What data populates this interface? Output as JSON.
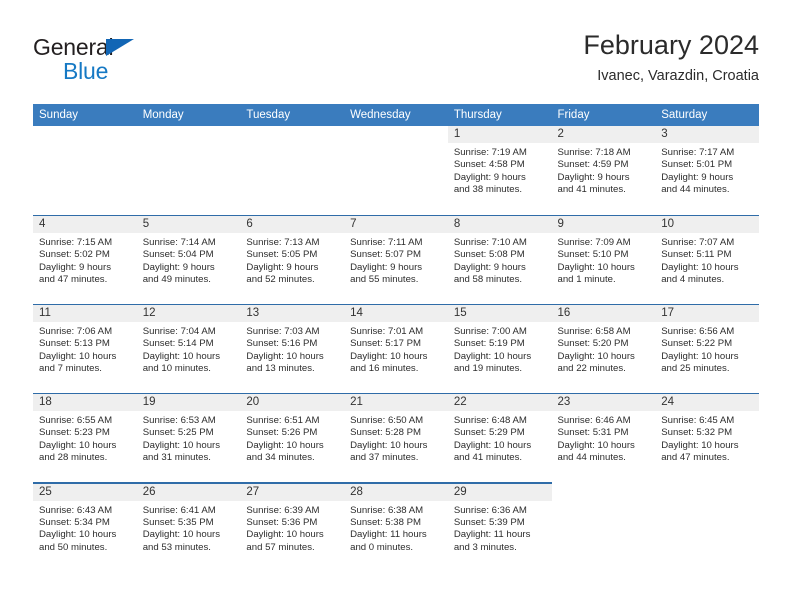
{
  "brand": {
    "name_part1": "General",
    "name_part2": "Blue",
    "colors": {
      "dark": "#231f20",
      "blue": "#1679c4",
      "triangle": "#1266b5"
    }
  },
  "header": {
    "title": "February 2024",
    "subtitle": "Ivanec, Varazdin, Croatia"
  },
  "theme": {
    "header_bg": "#3a7cbe",
    "header_text": "#ffffff",
    "row_divider": "#2f6ca8",
    "day_number_bg": "#efefef",
    "body_text": "#2d2d2d"
  },
  "weekdays": [
    "Sunday",
    "Monday",
    "Tuesday",
    "Wednesday",
    "Thursday",
    "Friday",
    "Saturday"
  ],
  "weeks": [
    [
      {
        "day": "",
        "sunrise": "",
        "sunset": "",
        "daylight_line1": "",
        "daylight_line2": "",
        "blank": true
      },
      {
        "day": "",
        "sunrise": "",
        "sunset": "",
        "daylight_line1": "",
        "daylight_line2": "",
        "blank": true
      },
      {
        "day": "",
        "sunrise": "",
        "sunset": "",
        "daylight_line1": "",
        "daylight_line2": "",
        "blank": true
      },
      {
        "day": "",
        "sunrise": "",
        "sunset": "",
        "daylight_line1": "",
        "daylight_line2": "",
        "blank": true
      },
      {
        "day": "1",
        "sunrise": "Sunrise: 7:19 AM",
        "sunset": "Sunset: 4:58 PM",
        "daylight_line1": "Daylight: 9 hours",
        "daylight_line2": "and 38 minutes."
      },
      {
        "day": "2",
        "sunrise": "Sunrise: 7:18 AM",
        "sunset": "Sunset: 4:59 PM",
        "daylight_line1": "Daylight: 9 hours",
        "daylight_line2": "and 41 minutes."
      },
      {
        "day": "3",
        "sunrise": "Sunrise: 7:17 AM",
        "sunset": "Sunset: 5:01 PM",
        "daylight_line1": "Daylight: 9 hours",
        "daylight_line2": "and 44 minutes."
      }
    ],
    [
      {
        "day": "4",
        "sunrise": "Sunrise: 7:15 AM",
        "sunset": "Sunset: 5:02 PM",
        "daylight_line1": "Daylight: 9 hours",
        "daylight_line2": "and 47 minutes."
      },
      {
        "day": "5",
        "sunrise": "Sunrise: 7:14 AM",
        "sunset": "Sunset: 5:04 PM",
        "daylight_line1": "Daylight: 9 hours",
        "daylight_line2": "and 49 minutes."
      },
      {
        "day": "6",
        "sunrise": "Sunrise: 7:13 AM",
        "sunset": "Sunset: 5:05 PM",
        "daylight_line1": "Daylight: 9 hours",
        "daylight_line2": "and 52 minutes."
      },
      {
        "day": "7",
        "sunrise": "Sunrise: 7:11 AM",
        "sunset": "Sunset: 5:07 PM",
        "daylight_line1": "Daylight: 9 hours",
        "daylight_line2": "and 55 minutes."
      },
      {
        "day": "8",
        "sunrise": "Sunrise: 7:10 AM",
        "sunset": "Sunset: 5:08 PM",
        "daylight_line1": "Daylight: 9 hours",
        "daylight_line2": "and 58 minutes."
      },
      {
        "day": "9",
        "sunrise": "Sunrise: 7:09 AM",
        "sunset": "Sunset: 5:10 PM",
        "daylight_line1": "Daylight: 10 hours",
        "daylight_line2": "and 1 minute."
      },
      {
        "day": "10",
        "sunrise": "Sunrise: 7:07 AM",
        "sunset": "Sunset: 5:11 PM",
        "daylight_line1": "Daylight: 10 hours",
        "daylight_line2": "and 4 minutes."
      }
    ],
    [
      {
        "day": "11",
        "sunrise": "Sunrise: 7:06 AM",
        "sunset": "Sunset: 5:13 PM",
        "daylight_line1": "Daylight: 10 hours",
        "daylight_line2": "and 7 minutes."
      },
      {
        "day": "12",
        "sunrise": "Sunrise: 7:04 AM",
        "sunset": "Sunset: 5:14 PM",
        "daylight_line1": "Daylight: 10 hours",
        "daylight_line2": "and 10 minutes."
      },
      {
        "day": "13",
        "sunrise": "Sunrise: 7:03 AM",
        "sunset": "Sunset: 5:16 PM",
        "daylight_line1": "Daylight: 10 hours",
        "daylight_line2": "and 13 minutes."
      },
      {
        "day": "14",
        "sunrise": "Sunrise: 7:01 AM",
        "sunset": "Sunset: 5:17 PM",
        "daylight_line1": "Daylight: 10 hours",
        "daylight_line2": "and 16 minutes."
      },
      {
        "day": "15",
        "sunrise": "Sunrise: 7:00 AM",
        "sunset": "Sunset: 5:19 PM",
        "daylight_line1": "Daylight: 10 hours",
        "daylight_line2": "and 19 minutes."
      },
      {
        "day": "16",
        "sunrise": "Sunrise: 6:58 AM",
        "sunset": "Sunset: 5:20 PM",
        "daylight_line1": "Daylight: 10 hours",
        "daylight_line2": "and 22 minutes."
      },
      {
        "day": "17",
        "sunrise": "Sunrise: 6:56 AM",
        "sunset": "Sunset: 5:22 PM",
        "daylight_line1": "Daylight: 10 hours",
        "daylight_line2": "and 25 minutes."
      }
    ],
    [
      {
        "day": "18",
        "sunrise": "Sunrise: 6:55 AM",
        "sunset": "Sunset: 5:23 PM",
        "daylight_line1": "Daylight: 10 hours",
        "daylight_line2": "and 28 minutes."
      },
      {
        "day": "19",
        "sunrise": "Sunrise: 6:53 AM",
        "sunset": "Sunset: 5:25 PM",
        "daylight_line1": "Daylight: 10 hours",
        "daylight_line2": "and 31 minutes."
      },
      {
        "day": "20",
        "sunrise": "Sunrise: 6:51 AM",
        "sunset": "Sunset: 5:26 PM",
        "daylight_line1": "Daylight: 10 hours",
        "daylight_line2": "and 34 minutes."
      },
      {
        "day": "21",
        "sunrise": "Sunrise: 6:50 AM",
        "sunset": "Sunset: 5:28 PM",
        "daylight_line1": "Daylight: 10 hours",
        "daylight_line2": "and 37 minutes."
      },
      {
        "day": "22",
        "sunrise": "Sunrise: 6:48 AM",
        "sunset": "Sunset: 5:29 PM",
        "daylight_line1": "Daylight: 10 hours",
        "daylight_line2": "and 41 minutes."
      },
      {
        "day": "23",
        "sunrise": "Sunrise: 6:46 AM",
        "sunset": "Sunset: 5:31 PM",
        "daylight_line1": "Daylight: 10 hours",
        "daylight_line2": "and 44 minutes."
      },
      {
        "day": "24",
        "sunrise": "Sunrise: 6:45 AM",
        "sunset": "Sunset: 5:32 PM",
        "daylight_line1": "Daylight: 10 hours",
        "daylight_line2": "and 47 minutes."
      }
    ],
    [
      {
        "day": "25",
        "sunrise": "Sunrise: 6:43 AM",
        "sunset": "Sunset: 5:34 PM",
        "daylight_line1": "Daylight: 10 hours",
        "daylight_line2": "and 50 minutes."
      },
      {
        "day": "26",
        "sunrise": "Sunrise: 6:41 AM",
        "sunset": "Sunset: 5:35 PM",
        "daylight_line1": "Daylight: 10 hours",
        "daylight_line2": "and 53 minutes."
      },
      {
        "day": "27",
        "sunrise": "Sunrise: 6:39 AM",
        "sunset": "Sunset: 5:36 PM",
        "daylight_line1": "Daylight: 10 hours",
        "daylight_line2": "and 57 minutes."
      },
      {
        "day": "28",
        "sunrise": "Sunrise: 6:38 AM",
        "sunset": "Sunset: 5:38 PM",
        "daylight_line1": "Daylight: 11 hours",
        "daylight_line2": "and 0 minutes."
      },
      {
        "day": "29",
        "sunrise": "Sunrise: 6:36 AM",
        "sunset": "Sunset: 5:39 PM",
        "daylight_line1": "Daylight: 11 hours",
        "daylight_line2": "and 3 minutes."
      },
      {
        "day": "",
        "sunrise": "",
        "sunset": "",
        "daylight_line1": "",
        "daylight_line2": "",
        "blank": true
      },
      {
        "day": "",
        "sunrise": "",
        "sunset": "",
        "daylight_line1": "",
        "daylight_line2": "",
        "blank": true
      }
    ]
  ]
}
